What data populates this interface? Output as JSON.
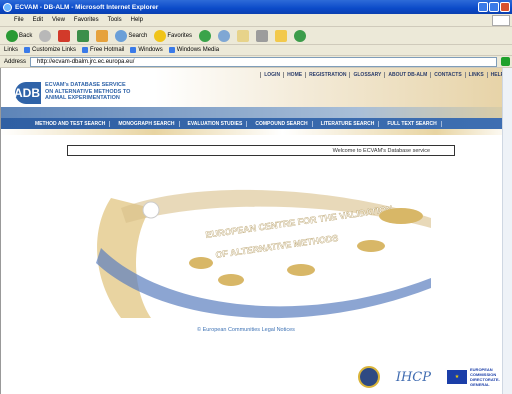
{
  "window": {
    "title": "ECVAM - DB-ALM - Microsoft Internet Explorer"
  },
  "menu": {
    "items": [
      "File",
      "Edit",
      "View",
      "Favorites",
      "Tools",
      "Help"
    ]
  },
  "toolbar": {
    "back": "Back",
    "search": "Search",
    "favorites": "Favorites"
  },
  "links": {
    "items": [
      "Customize Links",
      "Free Hotmail",
      "Windows",
      "Windows Media"
    ]
  },
  "address": {
    "label": "Address",
    "url": "http://ecvam-dbalm.jrc.ec.europa.eu/"
  },
  "site": {
    "top_nav": [
      "LOGIN",
      "HOME",
      "REGISTRATION",
      "GLOSSARY",
      "ABOUT DB-ALM",
      "CONTACTS",
      "LINKS",
      "HELP"
    ],
    "logo_text": "ADB",
    "logo_lines": [
      "ECVAM's DATABASE SERVICE",
      "ON ALTERNATIVE METHODS TO",
      "ANIMAL EXPERIMENTATION"
    ],
    "main_nav": [
      "METHOD AND TEST SEARCH",
      "MONOGRAPH SEARCH",
      "EVALUATION STUDIES",
      "COMPOUND SEARCH",
      "LITERATURE SEARCH",
      "FULL TEXT SEARCH"
    ],
    "welcome": "Welcome to ECVAM's Database service",
    "splash_title_1": "EUROPEAN CENTRE FOR THE VALIDATION",
    "splash_title_2": "OF ALTERNATIVE METHODS",
    "legal": "© European Communities Legal Notices",
    "ip_logo": "IHCP",
    "eu_text": "EUROPEAN COMMISSION DIRECTORATE-GENERAL"
  },
  "colors": {
    "accent": "#2f5fa3",
    "gold": "#e8d4a1",
    "titlebar": "#0b4ac9"
  }
}
